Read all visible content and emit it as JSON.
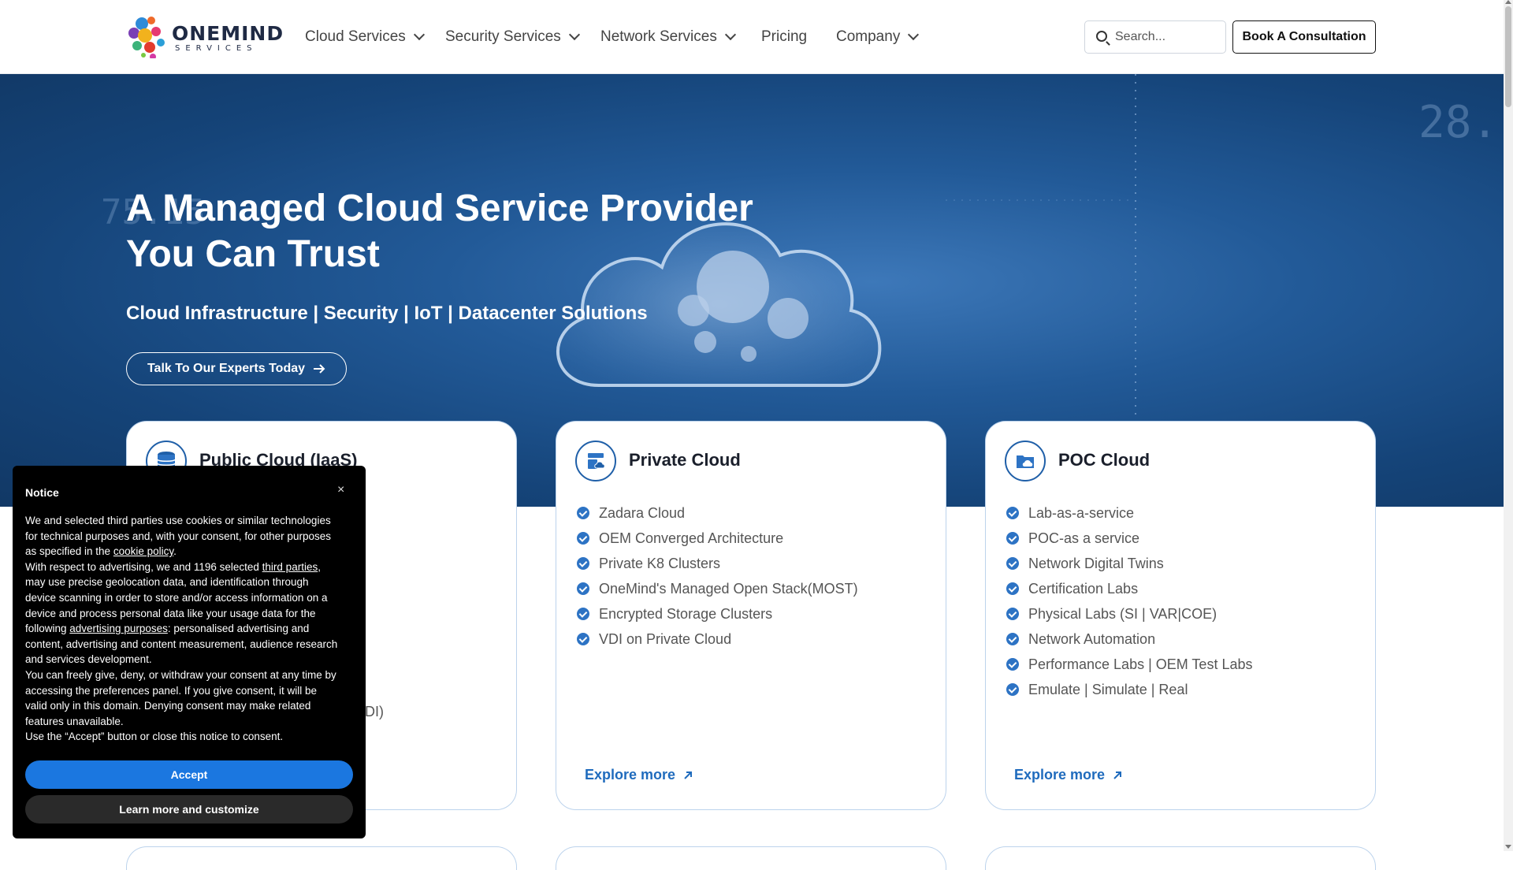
{
  "header": {
    "logo_word": "ONEMIND",
    "logo_sub": "SERVICES",
    "nav": [
      {
        "label": "Cloud Services",
        "has_dropdown": true
      },
      {
        "label": "Security Services",
        "has_dropdown": true
      },
      {
        "label": "Network Services",
        "has_dropdown": true
      },
      {
        "label": "Pricing",
        "has_dropdown": false
      },
      {
        "label": "Company",
        "has_dropdown": true
      }
    ],
    "search_placeholder": "Search...",
    "consult_label": "Book A Consultation"
  },
  "hero": {
    "title_line1": "A Managed Cloud Service Provider",
    "title_line2": "You Can Trust",
    "subtitle": "Cloud Infrastructure | Security | IoT | Datacenter Solutions",
    "cta_label": "Talk To Our Experts Today"
  },
  "cards": [
    {
      "title": "Public Cloud (IaaS)",
      "icon": "database-icon",
      "items": [
        "",
        "",
        "",
        "",
        "",
        "",
        "",
        "VDI)"
      ],
      "explore": "Explore more"
    },
    {
      "title": "Private Cloud",
      "icon": "cloud-server-icon",
      "items": [
        "Zadara Cloud",
        "OEM Converged Architecture",
        "Private K8 Clusters",
        "OneMind's Managed Open Stack(MOST)",
        "Encrypted Storage Clusters",
        "VDI on Private Cloud"
      ],
      "explore": "Explore more"
    },
    {
      "title": "POC Cloud",
      "icon": "folder-cloud-icon",
      "items": [
        "Lab-as-a-service",
        "POC-as a service",
        "Network Digital Twins",
        "Certification Labs",
        "Physical Labs (SI | VAR|COE)",
        "Network Automation",
        "Performance Labs | OEM Test Labs",
        "Emulate | Simulate | Real"
      ],
      "explore": "Explore more"
    }
  ],
  "notice": {
    "title": "Notice",
    "close": "×",
    "p1_a": "We and selected third parties use cookies or similar technologies for technical purposes and, with your consent, for other purposes as specified in the ",
    "p1_link": "cookie policy",
    "p1_b": ".",
    "p2_a": "With respect to advertising, we and 1196 selected ",
    "p2_link1": "third parties",
    "p2_b": ", may use precise geolocation data, and identification through device scanning in order to store and/or access information on a device and process personal data like your usage data for the following ",
    "p2_link2": "advertising purposes",
    "p2_c": ": personalised advertising and content, advertising and content measurement, audience research and services development.",
    "p3": "You can freely give, deny, or withdraw your consent at any time by accessing the preferences panel. If you give consent, it will be valid only in this domain. Denying consent may make related features unavailable.",
    "p4": "Use the “Accept” button or close this notice to consent.",
    "accept_label": "Accept",
    "learn_label": "Learn more and customize"
  },
  "colors": {
    "brand_blue": "#1f6bbd",
    "check_blue": "#2d73c4",
    "accept_blue": "#1b77e0",
    "hero_dark": "#113865"
  }
}
